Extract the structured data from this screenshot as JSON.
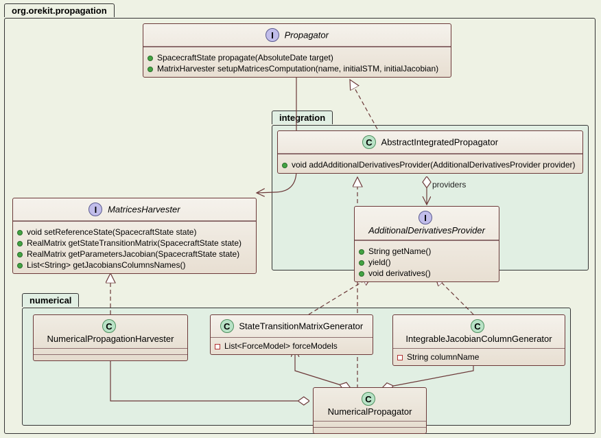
{
  "packages": {
    "outer": "org.orekit.propagation",
    "integration": "integration",
    "numerical": "numerical"
  },
  "relations": {
    "providers": "providers"
  },
  "classes": {
    "propagator": {
      "name": "Propagator",
      "members": [
        "SpacecraftState propagate(AbsoluteDate target)",
        "MatrixHarvester setupMatricesComputation(name, initialSTM, initialJacobian)"
      ]
    },
    "matricesHarvester": {
      "name": "MatricesHarvester",
      "members": [
        "void setReferenceState(SpacecraftState state)",
        "RealMatrix getStateTransitionMatrix(SpacecraftState state)",
        "RealMatrix getParametersJacobian(SpacecraftState state)",
        "List<String> getJacobiansColumnsNames()"
      ]
    },
    "abstractIntegratedPropagator": {
      "name": "AbstractIntegratedPropagator",
      "members": [
        "void addAdditionalDerivativesProvider(AdditionalDerivativesProvider provider)"
      ]
    },
    "additionalDerivativesProvider": {
      "name": "AdditionalDerivativesProvider",
      "members": [
        "String getName()",
        "yield()",
        "void derivatives()"
      ]
    },
    "numericalPropagationHarvester": {
      "name": "NumericalPropagationHarvester"
    },
    "stateTransitionMatrixGenerator": {
      "name": "StateTransitionMatrixGenerator",
      "members": [
        "List<ForceModel> forceModels"
      ]
    },
    "integrableJacobianColumnGenerator": {
      "name": "IntegrableJacobianColumnGenerator",
      "members": [
        "String columnName"
      ]
    },
    "numericalPropagator": {
      "name": "NumericalPropagator"
    }
  }
}
